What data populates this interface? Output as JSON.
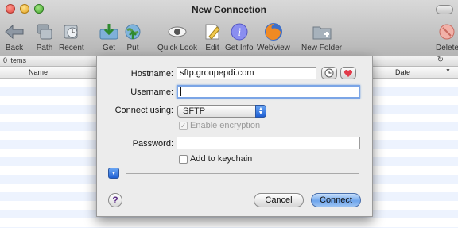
{
  "window": {
    "title": "New Connection"
  },
  "toolbar": {
    "items": [
      {
        "label": "Back"
      },
      {
        "label": "Path"
      },
      {
        "label": "Recent"
      },
      {
        "label": "Get"
      },
      {
        "label": "Put"
      },
      {
        "label": "Quick Look"
      },
      {
        "label": "Edit"
      },
      {
        "label": "Get Info"
      },
      {
        "label": "WebView"
      },
      {
        "label": "New Folder"
      },
      {
        "label": "Delete"
      }
    ]
  },
  "status": {
    "items_count": "0 items"
  },
  "columns": {
    "name": "Name",
    "date": "Date"
  },
  "sheet": {
    "hostname_label": "Hostname:",
    "hostname_value": "sftp.groupepdi.com",
    "username_label": "Username:",
    "username_value": "",
    "connect_using_label": "Connect using:",
    "connect_using_value": "SFTP",
    "enable_encryption_label": "Enable encryption",
    "password_label": "Password:",
    "password_value": "",
    "add_keychain_label": "Add to keychain",
    "help_label": "?",
    "cancel_label": "Cancel",
    "connect_label": "Connect"
  },
  "colors": {
    "accent": "#6ea5ec",
    "favorite": "#e23b4a"
  }
}
